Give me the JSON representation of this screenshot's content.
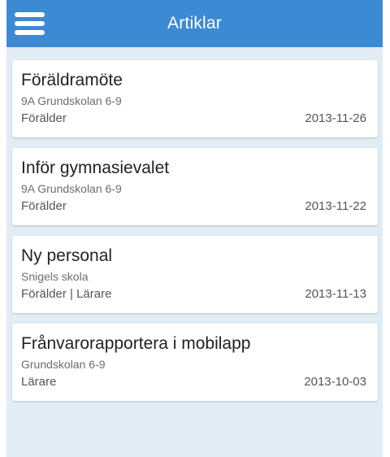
{
  "header": {
    "title": "Artiklar",
    "menu_icon": "hamburger-menu-icon",
    "background": "#3d8ad4"
  },
  "articles": [
    {
      "title": "Föräldramöte",
      "school": "9A Grundskolan 6-9",
      "audience": "Förälder",
      "date": "2013-11-26"
    },
    {
      "title": "Inför gymnasievalet",
      "school": "9A Grundskolan 6-9",
      "audience": "Förälder",
      "date": "2013-11-22"
    },
    {
      "title": "Ny personal",
      "school": "Snigels skola",
      "audience": "Förälder | Lärare",
      "date": "2013-11-13"
    },
    {
      "title": "Frånvarorapportera i mobilapp",
      "school": "Grundskolan 6-9",
      "audience": "Lärare",
      "date": "2013-10-03"
    }
  ]
}
